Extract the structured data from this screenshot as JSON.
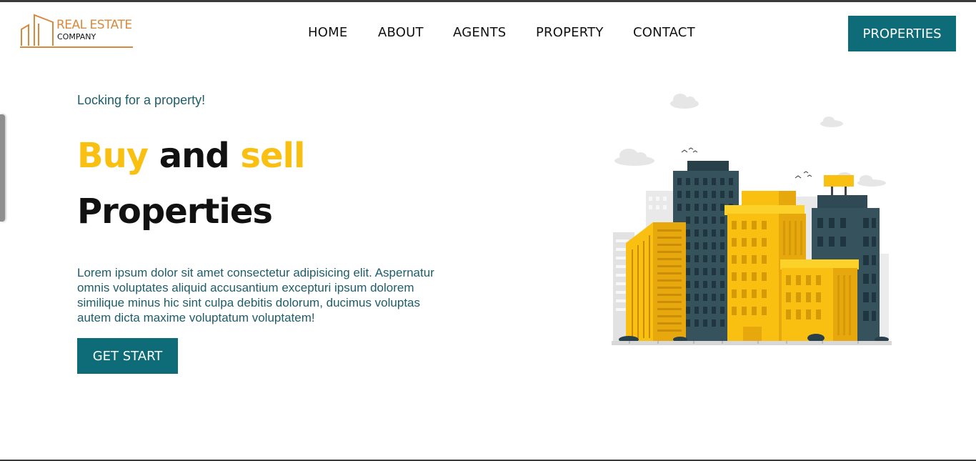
{
  "logo": {
    "line1": "REAL ESTATE",
    "line2": "COMPANY",
    "icon": "building-outline-icon",
    "color": "#d9893e"
  },
  "nav": {
    "items": [
      {
        "label": "HOME"
      },
      {
        "label": "ABOUT"
      },
      {
        "label": "AGENTS"
      },
      {
        "label": "PROPERTY"
      },
      {
        "label": "CONTACT"
      }
    ],
    "cta_label": "PROPERTIES"
  },
  "hero": {
    "tagline": "Locking for a property!",
    "headline_word1": "Buy",
    "headline_word2": "and",
    "headline_word3": "sell",
    "headline_line2": "Properties",
    "description": "Lorem ipsum dolor sit amet consectetur adipisicing elit. Aspernatur omnis voluptates aliquid accusantium excepturi ipsum dolorem similique minus hic sint culpa debitis dolorum, ducimus voluptas autem dicta maxime voluptatum voluptatem!",
    "cta_label": "GET START",
    "illustration": "city-buildings-illustration"
  },
  "colors": {
    "primary": "#0e6b78",
    "accent": "#f9c012",
    "text_teal": "#1d5d6a",
    "logo_orange": "#d9893e"
  }
}
